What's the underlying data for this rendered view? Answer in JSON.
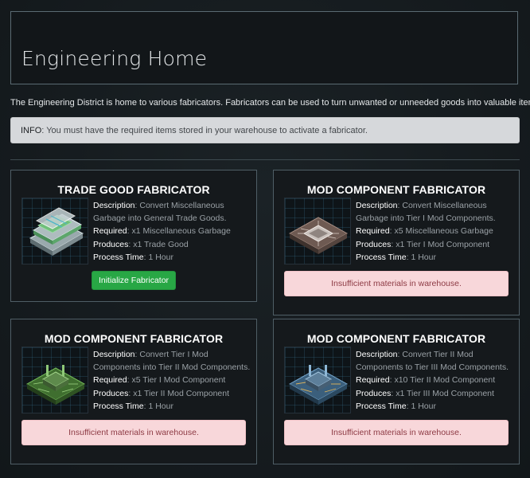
{
  "page": {
    "title": "Engineering Home",
    "intro": "The Engineering District is home to various fabricators. Fabricators can be used to turn unwanted or unneeded goods into valuable items.",
    "info_label": "INFO",
    "info_text": ": You must have the required items stored in your warehouse to activate a fabricator."
  },
  "labels": {
    "description": "Description",
    "required": "Required",
    "produces": "Produces",
    "process_time": "Process Time"
  },
  "cards": [
    {
      "title": "TRADE GOOD FABRICATOR",
      "description": ": Convert Miscellaneous Garbage into General Trade Goods.",
      "required": ": x1 Miscellaneous Garbage",
      "produces": ": x1 Trade Good",
      "process_time": ": 1 Hour",
      "action": "Initialize Fabricator",
      "icon": "trade-goods-icon",
      "accent": "#4fb6c8"
    },
    {
      "title": "MOD COMPONENT FABRICATOR",
      "description": ": Convert Miscellaneous Garbage into Tier I Mod Components.",
      "required": ": x5 Miscellaneous Garbage",
      "produces": ": x1 Tier I Mod Component",
      "process_time": ": 1 Hour",
      "status": "Insufficient materials in warehouse.",
      "icon": "circuit-chip-icon",
      "accent": "#8a6e62"
    },
    {
      "title": "MOD COMPONENT FABRICATOR",
      "description": ": Convert Tier I Mod Components into Tier II Mod Components.",
      "required": ": x5 Tier I Mod Component",
      "produces": ": x1 Tier II Mod Component",
      "process_time": ": 1 Hour",
      "status": "Insufficient materials in warehouse.",
      "icon": "circuit-chip-icon",
      "accent": "#4f9a3c"
    },
    {
      "title": "MOD COMPONENT FABRICATOR",
      "description": ": Convert Tier II Mod Components to Tier III Mod Components.",
      "required": ": x10 Tier II Mod Component",
      "produces": ": x1 Tier III Mod Component",
      "process_time": ": 1 Hour",
      "status": "Insufficient materials in warehouse.",
      "icon": "circuit-chip-icon",
      "accent": "#4b7fa6"
    }
  ],
  "colors": {
    "success_button": "#28a745",
    "danger_alert_bg": "#f8d7da",
    "info_alert_bg": "#d6d8db"
  }
}
